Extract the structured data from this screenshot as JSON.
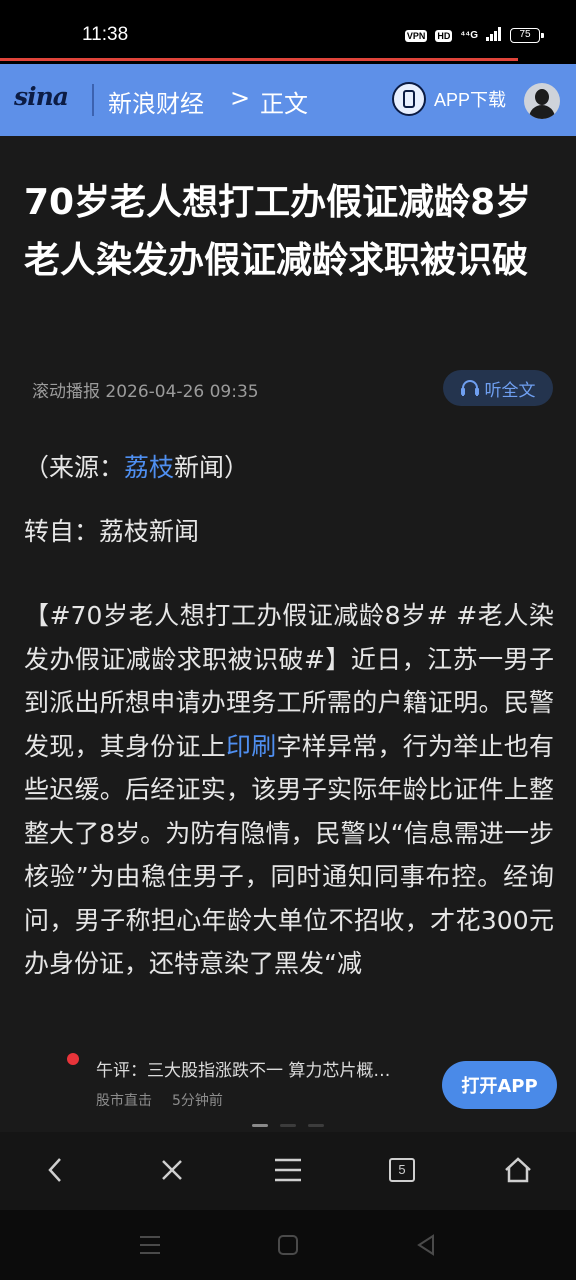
{
  "status_bar": {
    "time": "11:38",
    "vpn": "VPN",
    "hd": "HD",
    "network": "⁴⁴G",
    "battery": "75",
    "loading_progress_percent": 90
  },
  "header": {
    "logo_text": "sina",
    "brand": "新浪财经",
    "separator": ">",
    "current": "正文",
    "app_download": "APP下载"
  },
  "article": {
    "title": "70岁老人想打工办假证减龄8岁 老人染发办假证减龄求职被识破",
    "meta": "滚动播报 2026-04-26 09:35",
    "listen_button": "听全文",
    "source_prefix": "（来源：",
    "source_link": "荔枝",
    "source_suffix": "新闻）",
    "repost": "转自：荔枝新闻",
    "body_part1": "【#70岁老人想打工办假证减龄8岁# #老人染发办假证减龄求职被识破#】近日，江苏一男子到派出所想申请办理务工所需的户籍证明。民警发现，其身份证上",
    "body_link": "印刷",
    "body_part2": "字样异常，行为举止也有些迟缓。后经证实，该男子实际年龄比证件上整整大了8岁。为防有隐情，民警以“信息需进一步核验”为由稳住男子，同时通知同事布控。经询问，男子称担心年龄大单位不招收，才花300元办身份证，还特意染了黑发“减"
  },
  "ticker": {
    "headline": "午评：三大股指涨跌不一 算力芯片概…",
    "source": "股市直击",
    "time": "5分钟前",
    "open_app": "打开APP"
  },
  "toolbar": {
    "tabs_count": "5"
  },
  "colors": {
    "header_bg": "#5e90e8",
    "link": "#4f8ff0",
    "progress": "#e0443a",
    "open_app_bg": "#4a8ae8"
  },
  "icons": [
    "back-icon",
    "close-icon",
    "menu-icon",
    "tabs-icon",
    "home-icon",
    "headphones-icon",
    "phone-icon",
    "recent-apps-icon",
    "system-home-icon",
    "system-back-icon"
  ]
}
